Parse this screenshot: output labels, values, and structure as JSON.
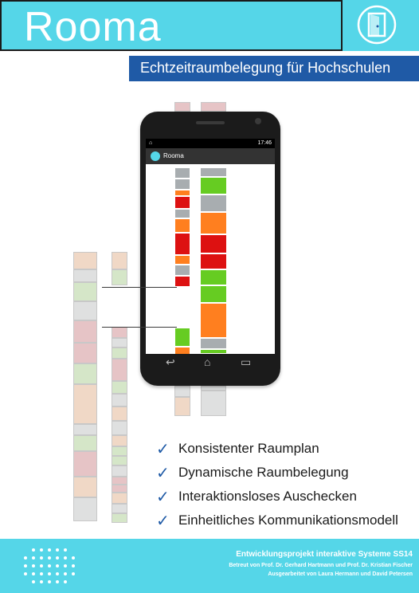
{
  "header": {
    "title": "Rooma",
    "subtitle": "Echtzeitraumbelegung für Hochschulen",
    "logo_icon": "door-icon"
  },
  "colors": {
    "accent": "#55d6e8",
    "navy": "#1f5aa6",
    "free": "#66cc22",
    "busy": "#dd1111",
    "reserved": "#ff7f1f",
    "unknown": "#a8adb0"
  },
  "phone": {
    "time": "17:46",
    "app_name": "Rooma"
  },
  "features": [
    "Konsistenter Raumplan",
    "Dynamische Raumbelegung",
    "Interaktionsloses Auschecken",
    "Einheitliches Kommunikationsmodell"
  ],
  "footer": {
    "line1": "Entwicklungsprojekt interaktive Systeme SS14",
    "line2": "Betreut von Prof. Dr. Gerhard Hartmann und Prof. Dr. Kristian Fischer",
    "line3": "Ausgearbeitet von Laura Hermann und David Petersen"
  }
}
